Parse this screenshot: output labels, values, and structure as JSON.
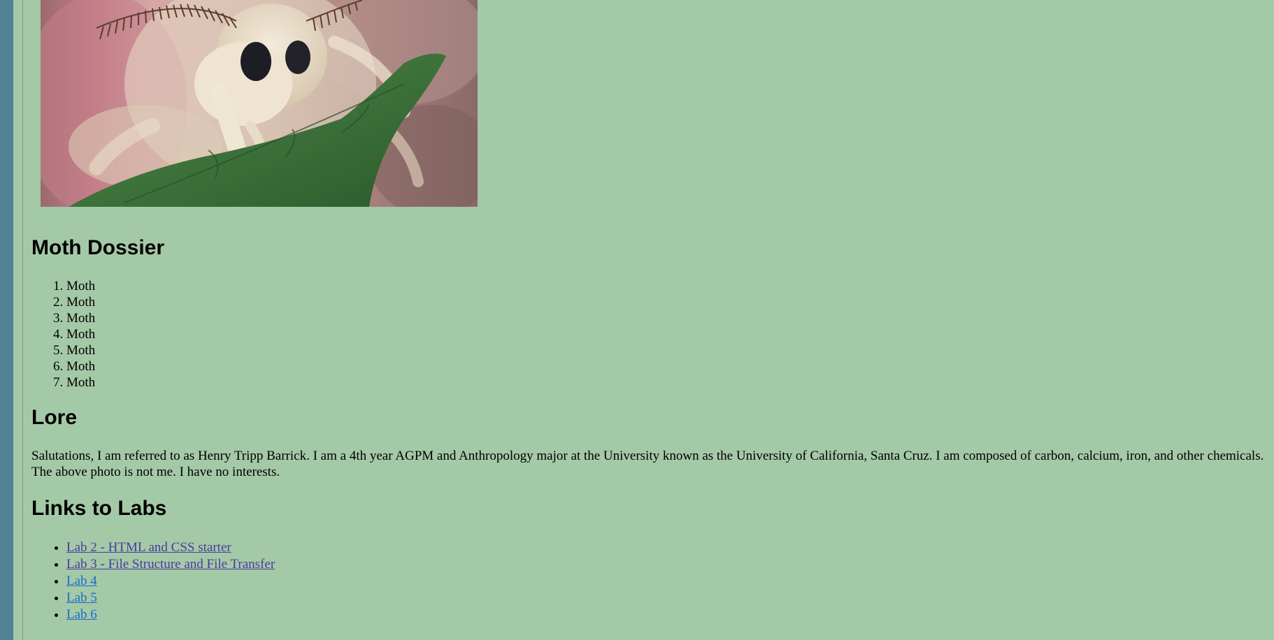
{
  "photo": {
    "alt": "Silk moth on a leaf"
  },
  "sections": {
    "dossier_title": "Moth Dossier",
    "dossier_items": [
      "Moth",
      "Moth",
      "Moth",
      "Moth",
      "Moth",
      "Moth",
      "Moth"
    ],
    "lore_title": "Lore",
    "lore_text": "Salutations, I am referred to as Henry Tripp Barrick. I am a 4th year AGPM and Anthropology major at the University known as the University of California, Santa Cruz. I am composed of carbon, calcium, iron, and other chemicals. The above photo is not me. I have no interests.",
    "links_title": "Links to Labs",
    "links": [
      {
        "label": "Lab 2 - HTML and CSS starter",
        "visited": true
      },
      {
        "label": "Lab 3 - File Structure and File Transfer",
        "visited": true
      },
      {
        "label": "Lab 4",
        "visited": false
      },
      {
        "label": "Lab 5",
        "visited": false
      },
      {
        "label": "Lab 6",
        "visited": false
      }
    ]
  },
  "colors": {
    "background": "#a4c9a7",
    "sidebar": "#4f8294",
    "link_visited": "#4b3aa0",
    "link_unvisited": "#1a6bd0"
  }
}
